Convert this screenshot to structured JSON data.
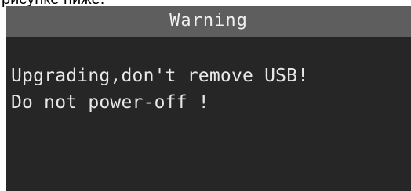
{
  "page": {
    "caption": "рисунке ниже."
  },
  "dialog": {
    "title": "Warning",
    "lines": [
      "Upgrading,don't remove USB!",
      "Do not power-off !"
    ]
  },
  "colors": {
    "header_bg": "#5e5e5e",
    "body_bg": "#262626",
    "text": "#e8e8e8"
  }
}
